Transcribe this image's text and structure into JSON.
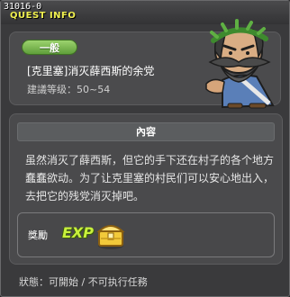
{
  "window": {
    "quest_id": "31016-0",
    "header": "QUEST INFO"
  },
  "info": {
    "category": "一般",
    "name": "[克里塞]消灭薛西斯的余党",
    "level": "建議等级：50~54"
  },
  "content": {
    "header": "內容",
    "text": "虽然消灭了薛西斯，但它的手下还在村子的各个地方蠢蠢欲动。为了让克里塞的村民们可以安心地出入，去把它的残党消灭掉吧。"
  },
  "reward": {
    "label": "獎勵",
    "exp_label": "EXP",
    "icons": [
      "exp-icon",
      "treasure-chest-icon"
    ]
  },
  "status": {
    "text": "狀態：可開始 / 不可执行任務"
  },
  "colors": {
    "header_yellow": "#f0f050",
    "badge_green": "#6fb044",
    "exp_green": "#c8f03c",
    "panel_bg": "#3a3a3c"
  }
}
